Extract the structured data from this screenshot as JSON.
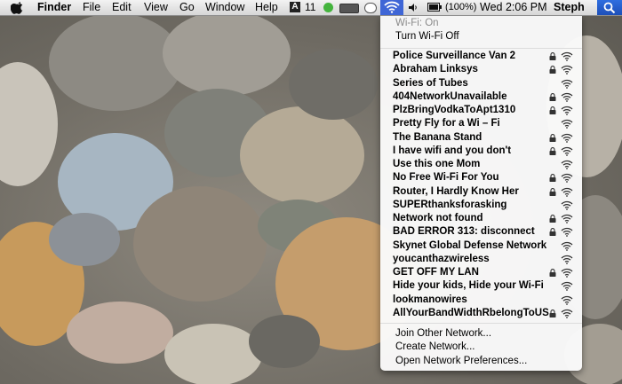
{
  "menubar": {
    "app_name": "Finder",
    "menus": [
      "File",
      "Edit",
      "View",
      "Go",
      "Window",
      "Help"
    ],
    "adobe_count": "11",
    "battery_percent": "(100%)",
    "clock": "Wed 2:06 PM",
    "user": "Steph"
  },
  "wifi_menu": {
    "status": "Wi-Fi: On",
    "toggle_label": "Turn Wi-Fi Off",
    "networks": [
      {
        "name": "Police Surveillance Van 2",
        "locked": true
      },
      {
        "name": "Abraham Linksys",
        "locked": true
      },
      {
        "name": "Series of Tubes",
        "locked": false
      },
      {
        "name": "404NetworkUnavailable",
        "locked": true
      },
      {
        "name": "PlzBringVodkaToApt1310",
        "locked": true
      },
      {
        "name": "Pretty Fly for a Wi – Fi",
        "locked": false
      },
      {
        "name": "The Banana Stand",
        "locked": true
      },
      {
        "name": "I have wifi and you don't",
        "locked": true
      },
      {
        "name": "Use this one Mom",
        "locked": false
      },
      {
        "name": "No Free Wi-Fi For You",
        "locked": true
      },
      {
        "name": "Router, I Hardly Know Her",
        "locked": true
      },
      {
        "name": "SUPERthanksforasking",
        "locked": false
      },
      {
        "name": "Network not found",
        "locked": true
      },
      {
        "name": "BAD ERROR 313: disconnect",
        "locked": true
      },
      {
        "name": "Skynet Global Defense Network",
        "locked": false
      },
      {
        "name": "youcanthazwireless",
        "locked": false
      },
      {
        "name": "GET OFF MY LAN",
        "locked": true
      },
      {
        "name": "Hide your kids, Hide your Wi-Fi",
        "locked": false
      },
      {
        "name": "lookmanowires",
        "locked": false
      },
      {
        "name": "AllYourBandWidthRbelongToUS",
        "locked": true
      }
    ],
    "join_other": "Join Other Network...",
    "create_network": "Create Network...",
    "open_prefs": "Open Network Preferences..."
  }
}
